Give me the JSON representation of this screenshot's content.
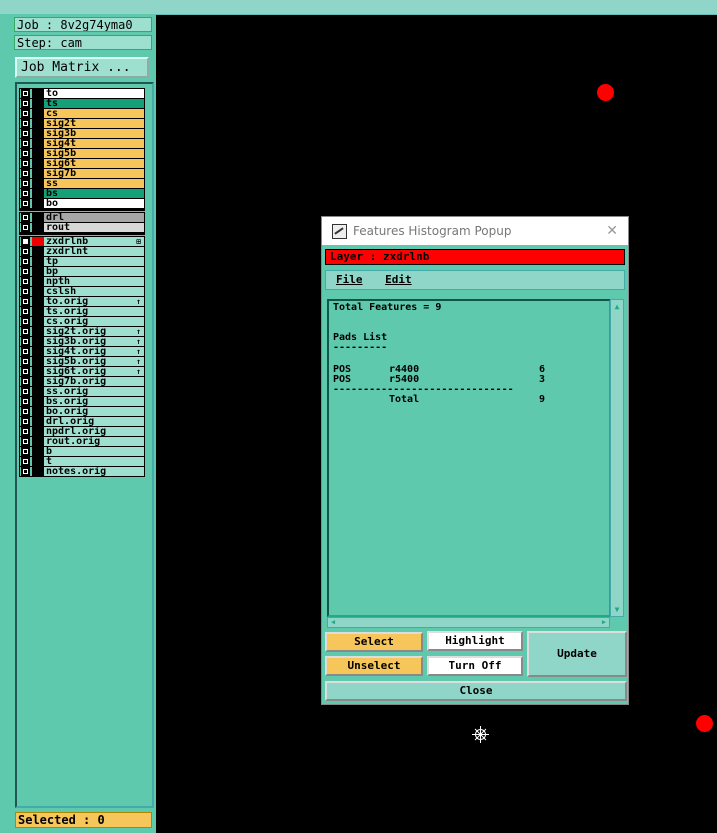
{
  "job": "Job : 8v2g74yma0",
  "step": "Step: cam",
  "job_matrix": "Job Matrix ...",
  "layers": [
    {
      "name": "to",
      "color": "#ffffff",
      "sel": false,
      "mark": ""
    },
    {
      "name": "ts",
      "color": "#16a078",
      "sel": false,
      "mark": ""
    },
    {
      "name": "cs",
      "color": "#f6c65b",
      "sel": false,
      "mark": ""
    },
    {
      "name": "sig2t",
      "color": "#f6c65b",
      "sel": false,
      "mark": ""
    },
    {
      "name": "sig3b",
      "color": "#f6c65b",
      "sel": false,
      "mark": ""
    },
    {
      "name": "sig4t",
      "color": "#f6c65b",
      "sel": false,
      "mark": ""
    },
    {
      "name": "sig5b",
      "color": "#f6c65b",
      "sel": false,
      "mark": ""
    },
    {
      "name": "sig6t",
      "color": "#f6c65b",
      "sel": false,
      "mark": ""
    },
    {
      "name": "sig7b",
      "color": "#f6c65b",
      "sel": false,
      "mark": ""
    },
    {
      "name": "ss",
      "color": "#f6c65b",
      "sel": false,
      "mark": ""
    },
    {
      "name": "bs",
      "color": "#16a078",
      "sel": false,
      "mark": ""
    },
    {
      "name": "bo",
      "color": "#ffffff",
      "sel": false,
      "mark": ""
    },
    {
      "name": "drl",
      "color": "#a6a6a6",
      "sel": false,
      "mark": ""
    },
    {
      "name": "rout",
      "color": "#d8d8d8",
      "sel": false,
      "mark": ""
    },
    {
      "name": "zxdrlnb",
      "color": "#9ee0d0",
      "sel": true,
      "mark": "⊞"
    },
    {
      "name": "zxdrlnt",
      "color": "#9ee0d0",
      "sel": false,
      "mark": ""
    },
    {
      "name": "tp",
      "color": "#9ee0d0",
      "sel": false,
      "mark": ""
    },
    {
      "name": "bp",
      "color": "#9ee0d0",
      "sel": false,
      "mark": ""
    },
    {
      "name": "npth",
      "color": "#9ee0d0",
      "sel": false,
      "mark": ""
    },
    {
      "name": "cslsh",
      "color": "#9ee0d0",
      "sel": false,
      "mark": ""
    },
    {
      "name": "to.orig",
      "color": "#9ee0d0",
      "sel": false,
      "mark": "↑"
    },
    {
      "name": "ts.orig",
      "color": "#9ee0d0",
      "sel": false,
      "mark": ""
    },
    {
      "name": "cs.orig",
      "color": "#9ee0d0",
      "sel": false,
      "mark": ""
    },
    {
      "name": "sig2t.orig",
      "color": "#9ee0d0",
      "sel": false,
      "mark": "↑"
    },
    {
      "name": "sig3b.orig",
      "color": "#9ee0d0",
      "sel": false,
      "mark": "↑"
    },
    {
      "name": "sig4t.orig",
      "color": "#9ee0d0",
      "sel": false,
      "mark": "↑"
    },
    {
      "name": "sig5b.orig",
      "color": "#9ee0d0",
      "sel": false,
      "mark": "↑"
    },
    {
      "name": "sig6t.orig",
      "color": "#9ee0d0",
      "sel": false,
      "mark": "↑"
    },
    {
      "name": "sig7b.orig",
      "color": "#9ee0d0",
      "sel": false,
      "mark": ""
    },
    {
      "name": "ss.orig",
      "color": "#9ee0d0",
      "sel": false,
      "mark": ""
    },
    {
      "name": "bs.orig",
      "color": "#9ee0d0",
      "sel": false,
      "mark": ""
    },
    {
      "name": "bo.orig",
      "color": "#9ee0d0",
      "sel": false,
      "mark": ""
    },
    {
      "name": "drl.orig",
      "color": "#9ee0d0",
      "sel": false,
      "mark": ""
    },
    {
      "name": "npdrl.orig",
      "color": "#9ee0d0",
      "sel": false,
      "mark": ""
    },
    {
      "name": "rout.orig",
      "color": "#9ee0d0",
      "sel": false,
      "mark": ""
    },
    {
      "name": "b",
      "color": "#9ee0d0",
      "sel": false,
      "mark": ""
    },
    {
      "name": "t",
      "color": "#9ee0d0",
      "sel": false,
      "mark": ""
    },
    {
      "name": "notes.orig",
      "color": "#9ee0d0",
      "sel": false,
      "mark": ""
    }
  ],
  "selected": "Selected : 0",
  "popup": {
    "title": "Features Histogram Popup",
    "close_glyph": "✕",
    "layer": "Layer : zxdrlnb",
    "menu": {
      "file": "File",
      "edit": "Edit"
    },
    "text": {
      "total_features": "Total Features = 9",
      "pads_list": "Pads List",
      "pads_underline": "---------",
      "rows": [
        {
          "type": "POS",
          "sym": "r4400",
          "count": "6"
        },
        {
          "type": "POS",
          "sym": "r5400",
          "count": "3"
        }
      ],
      "rule": "------------------------------",
      "total_label": "Total",
      "total_value": "9"
    },
    "buttons": {
      "select": "Select",
      "highlight": "Highlight",
      "update": "Update",
      "unselect": "Unselect",
      "turn_off": "Turn Off",
      "close": "Close"
    },
    "scroll": {
      "up": "▲",
      "down": "▼",
      "left": "◀",
      "right": "▶"
    }
  }
}
